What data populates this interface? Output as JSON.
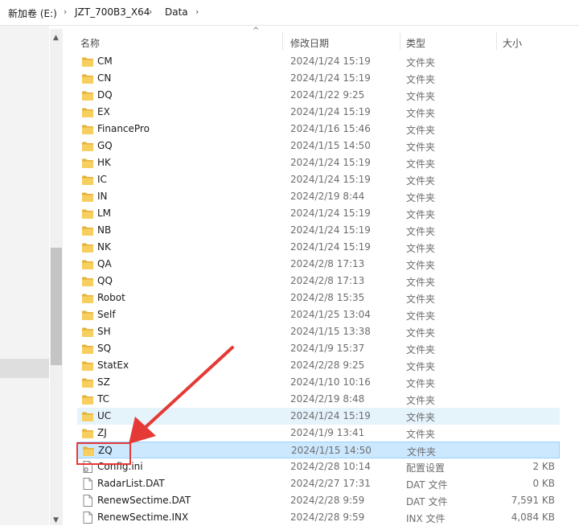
{
  "breadcrumb": {
    "drive": "新加卷 (E:)",
    "folder": "JZT_700B3_X64",
    "current": "Data",
    "separator": "›"
  },
  "columns": {
    "name": "名称",
    "date": "修改日期",
    "type": "类型",
    "size": "大小"
  },
  "rows": [
    {
      "name": "CM",
      "date": "2024/1/24 15:19",
      "type": "文件夹",
      "size": "",
      "icon": "folder-icon"
    },
    {
      "name": "CN",
      "date": "2024/1/24 15:19",
      "type": "文件夹",
      "size": "",
      "icon": "folder-icon"
    },
    {
      "name": "DQ",
      "date": "2024/1/22 9:25",
      "type": "文件夹",
      "size": "",
      "icon": "folder-icon"
    },
    {
      "name": "EX",
      "date": "2024/1/24 15:19",
      "type": "文件夹",
      "size": "",
      "icon": "folder-icon"
    },
    {
      "name": "FinancePro",
      "date": "2024/1/16 15:46",
      "type": "文件夹",
      "size": "",
      "icon": "folder-icon"
    },
    {
      "name": "GQ",
      "date": "2024/1/15 14:50",
      "type": "文件夹",
      "size": "",
      "icon": "folder-icon"
    },
    {
      "name": "HK",
      "date": "2024/1/24 15:19",
      "type": "文件夹",
      "size": "",
      "icon": "folder-icon"
    },
    {
      "name": "IC",
      "date": "2024/1/24 15:19",
      "type": "文件夹",
      "size": "",
      "icon": "folder-icon"
    },
    {
      "name": "IN",
      "date": "2024/2/19 8:44",
      "type": "文件夹",
      "size": "",
      "icon": "folder-icon"
    },
    {
      "name": "LM",
      "date": "2024/1/24 15:19",
      "type": "文件夹",
      "size": "",
      "icon": "folder-icon"
    },
    {
      "name": "NB",
      "date": "2024/1/24 15:19",
      "type": "文件夹",
      "size": "",
      "icon": "folder-icon"
    },
    {
      "name": "NK",
      "date": "2024/1/24 15:19",
      "type": "文件夹",
      "size": "",
      "icon": "folder-icon"
    },
    {
      "name": "QA",
      "date": "2024/2/8 17:13",
      "type": "文件夹",
      "size": "",
      "icon": "folder-icon"
    },
    {
      "name": "QQ",
      "date": "2024/2/8 17:13",
      "type": "文件夹",
      "size": "",
      "icon": "folder-icon"
    },
    {
      "name": "Robot",
      "date": "2024/2/8 15:35",
      "type": "文件夹",
      "size": "",
      "icon": "folder-icon"
    },
    {
      "name": "Self",
      "date": "2024/1/25 13:04",
      "type": "文件夹",
      "size": "",
      "icon": "folder-icon"
    },
    {
      "name": "SH",
      "date": "2024/1/15 13:38",
      "type": "文件夹",
      "size": "",
      "icon": "folder-icon"
    },
    {
      "name": "SQ",
      "date": "2024/1/9 15:37",
      "type": "文件夹",
      "size": "",
      "icon": "folder-icon"
    },
    {
      "name": "StatEx",
      "date": "2024/2/28 9:25",
      "type": "文件夹",
      "size": "",
      "icon": "folder-icon"
    },
    {
      "name": "SZ",
      "date": "2024/1/10 10:16",
      "type": "文件夹",
      "size": "",
      "icon": "folder-icon"
    },
    {
      "name": "TC",
      "date": "2024/2/19 8:48",
      "type": "文件夹",
      "size": "",
      "icon": "folder-icon"
    },
    {
      "name": "UC",
      "date": "2024/1/24 15:19",
      "type": "文件夹",
      "size": "",
      "icon": "folder-icon",
      "state": "hover"
    },
    {
      "name": "ZJ",
      "date": "2024/1/9 13:41",
      "type": "文件夹",
      "size": "",
      "icon": "folder-icon"
    },
    {
      "name": "ZQ",
      "date": "2024/1/15 14:50",
      "type": "文件夹",
      "size": "",
      "icon": "folder-icon",
      "state": "selected"
    },
    {
      "name": "Config.ini",
      "date": "2024/2/28 10:14",
      "type": "配置设置",
      "size": "2 KB",
      "icon": "settings-file-icon"
    },
    {
      "name": "RadarList.DAT",
      "date": "2024/2/27 17:31",
      "type": "DAT 文件",
      "size": "0 KB",
      "icon": "file-icon"
    },
    {
      "name": "RenewSectime.DAT",
      "date": "2024/2/28 9:59",
      "type": "DAT 文件",
      "size": "7,591 KB",
      "icon": "file-icon"
    },
    {
      "name": "RenewSectime.INX",
      "date": "2024/2/28 9:59",
      "type": "INX 文件",
      "size": "4,084 KB",
      "icon": "file-icon"
    }
  ],
  "colors": {
    "folder": "#f7cf5e",
    "folder_dark": "#e4b23a",
    "selection": "#cce8ff",
    "hover": "#e5f3fb",
    "annotation": "#e53935"
  }
}
